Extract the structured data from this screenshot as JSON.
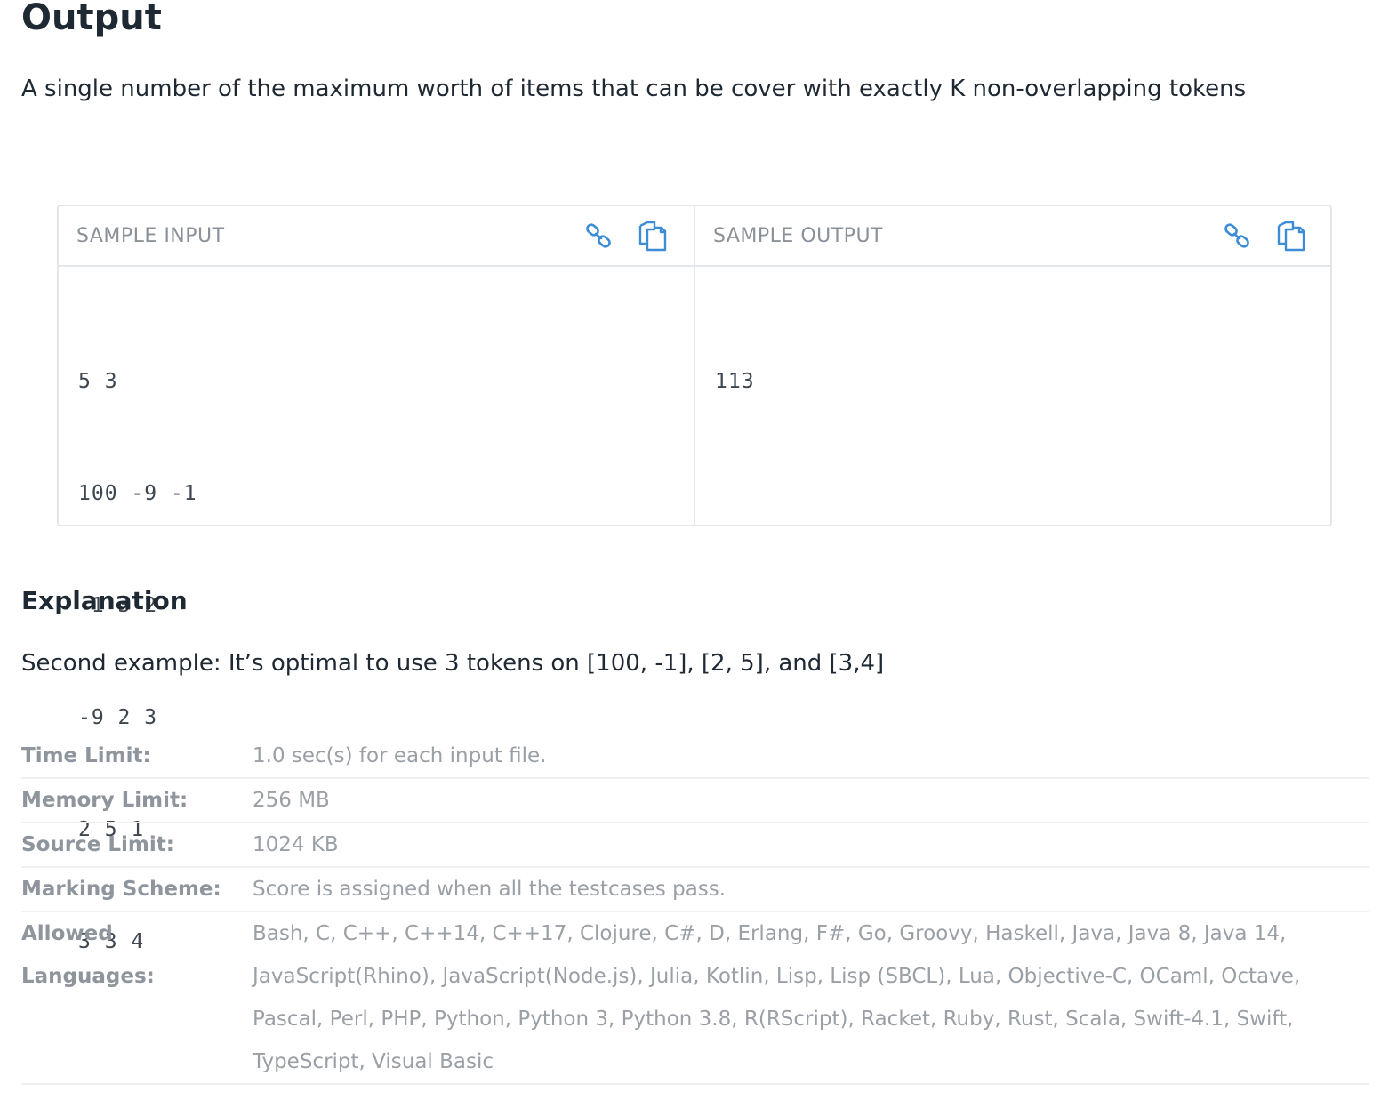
{
  "output_section": {
    "title": "Output",
    "description": "A single number of the maximum worth of items that can be cover with exactly K non-overlapping tokens"
  },
  "samples": {
    "input": {
      "label": "SAMPLE INPUT",
      "lines": [
        "5 3",
        "100 -9 -1",
        "-1 3 2",
        "-9 2 3",
        "2 5 1",
        "3 3 4"
      ],
      "link_icon": "link-icon",
      "copy_icon": "copy-icon"
    },
    "output": {
      "label": "SAMPLE OUTPUT",
      "lines": [
        "113"
      ],
      "link_icon": "link-icon",
      "copy_icon": "copy-icon"
    },
    "icon_color": "#3c8dd6"
  },
  "explanation": {
    "title": "Explanation",
    "text": "Second example: It’s optimal to use 3 tokens on [100, -1], [2, 5], and [3,4]"
  },
  "limits": [
    {
      "key": "Time Limit:",
      "value": "1.0 sec(s) for each input file."
    },
    {
      "key": "Memory Limit:",
      "value": "256 MB"
    },
    {
      "key": "Source Limit:",
      "value": "1024 KB"
    },
    {
      "key": "Marking Scheme:",
      "value": "Score is assigned when all the testcases pass."
    },
    {
      "key": "Allowed Languages:",
      "value": "Bash, C, C++, C++14, C++17, Clojure, C#, D, Erlang, F#, Go, Groovy, Haskell, Java, Java 8, Java 14, JavaScript(Rhino), JavaScript(Node.js), Julia, Kotlin, Lisp, Lisp (SBCL), Lua, Objective-C, OCaml, Octave, Pascal, Perl, PHP, Python, Python 3, Python 3.8, R(RScript), Racket, Ruby, Rust, Scala, Swift-4.1, Swift, TypeScript, Visual Basic"
    }
  ]
}
